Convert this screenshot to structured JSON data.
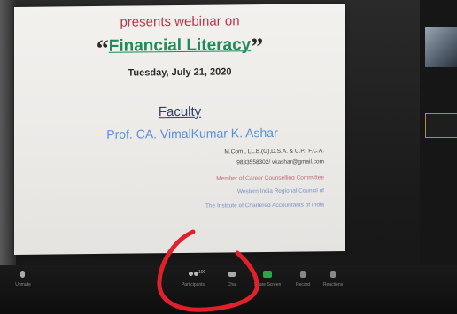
{
  "slide": {
    "intro": "presents webinar on",
    "open_quote": "“",
    "title": "Financial Literacy",
    "close_quote": "”",
    "date": "Tuesday, July 21, 2020",
    "faculty_heading": "Faculty",
    "speaker": "Prof. CA. VimalKumar K. Ashar",
    "degrees": "M.Com., LL.B.(G),D.S.A. & C.P., F.C.A.",
    "contact": "9833558302/ vkashar@gmail.com",
    "member_line": "Member of Career Counselling Committee",
    "council_line": "Western India Regional Council of",
    "institute_line": "The Institute of Chartered Accountants of India",
    "colors": {
      "intro": "#c0334a",
      "title": "#1f8a5a",
      "speaker": "#5a8fd8",
      "heading": "#2f3f6e"
    }
  },
  "toolbar": {
    "buttons": [
      {
        "icon": "mic-icon",
        "label": "Unmute"
      },
      {
        "icon": "participants-icon",
        "label": "Participants",
        "count": "100"
      },
      {
        "icon": "chat-icon",
        "label": "Chat"
      },
      {
        "icon": "share-screen-icon",
        "label": "Share Screen"
      },
      {
        "icon": "record-icon",
        "label": "Record"
      },
      {
        "icon": "reactions-icon",
        "label": "Reactions"
      }
    ]
  },
  "annotation": {
    "color": "#e0202a",
    "target": "participants-button"
  }
}
